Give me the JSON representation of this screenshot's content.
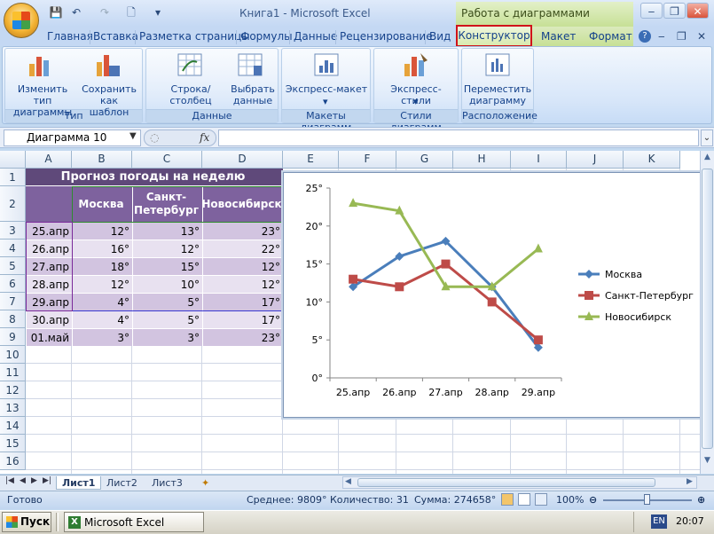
{
  "window": {
    "title": "Книга1 - Microsoft Excel",
    "context_title": "Работа с диаграммами"
  },
  "tabs": [
    "Главная",
    "Вставка",
    "Разметка страницы",
    "Формулы",
    "Данные",
    "Рецензирование",
    "Вид"
  ],
  "context_tabs": [
    "Конструктор",
    "Макет",
    "Формат"
  ],
  "ribbon": {
    "groups": [
      {
        "label": "Тип",
        "buttons": [
          "Изменить тип диаграммы",
          "Сохранить как шаблон"
        ]
      },
      {
        "label": "Данные",
        "buttons": [
          "Строка/столбец",
          "Выбрать данные"
        ]
      },
      {
        "label": "Макеты диаграмм",
        "buttons": [
          "Экспресс-макет"
        ]
      },
      {
        "label": "Стили диаграмм",
        "buttons": [
          "Экспресс-стили"
        ]
      },
      {
        "label": "Расположение",
        "buttons": [
          "Переместить диаграмму"
        ]
      }
    ]
  },
  "formula_bar": {
    "name_box": "Диаграмма 10",
    "fx": "fx",
    "value": ""
  },
  "columns": [
    "A",
    "B",
    "C",
    "D",
    "E",
    "F",
    "G",
    "H",
    "I",
    "J",
    "K"
  ],
  "rows": [
    "1",
    "2",
    "3",
    "4",
    "5",
    "6",
    "7",
    "8",
    "9",
    "10",
    "11",
    "12",
    "13",
    "14",
    "15",
    "16"
  ],
  "table": {
    "title": "Прогноз погоды на неделю",
    "headers": [
      "Москва",
      "Санкт-Петербург",
      "Новосибирск"
    ],
    "data": [
      [
        "25.апр",
        "12°",
        "13°",
        "23°"
      ],
      [
        "26.апр",
        "16°",
        "12°",
        "22°"
      ],
      [
        "27.апр",
        "18°",
        "15°",
        "12°"
      ],
      [
        "28.апр",
        "12°",
        "10°",
        "12°"
      ],
      [
        "29.апр",
        "4°",
        "5°",
        "17°"
      ],
      [
        "30.апр",
        "4°",
        "5°",
        "17°"
      ],
      [
        "01.май",
        "3°",
        "3°",
        "23°"
      ]
    ]
  },
  "chart_data": {
    "type": "line",
    "categories": [
      "25.апр",
      "26.апр",
      "27.апр",
      "28.апр",
      "29.апр"
    ],
    "series": [
      {
        "name": "Москва",
        "values": [
          12,
          16,
          18,
          12,
          4
        ],
        "color": "#4a7ebb",
        "marker": "diamond"
      },
      {
        "name": "Санкт-Петербург",
        "values": [
          13,
          12,
          15,
          10,
          5
        ],
        "color": "#be4b48",
        "marker": "square"
      },
      {
        "name": "Новосибирск",
        "values": [
          23,
          22,
          12,
          12,
          17
        ],
        "color": "#98b954",
        "marker": "triangle"
      }
    ],
    "yticks": [
      "0°",
      "5°",
      "10°",
      "15°",
      "20°",
      "25°"
    ],
    "ylim": [
      0,
      25
    ],
    "legend": "right",
    "grid": false
  },
  "sheets": [
    "Лист1",
    "Лист2",
    "Лист3"
  ],
  "active_sheet": "Лист1",
  "status": {
    "ready": "Готово",
    "average": "Среднее: 9809°",
    "count": "Количество: 31",
    "sum": "Сумма: 274658°",
    "zoom": "100%"
  },
  "taskbar": {
    "start": "Пуск",
    "task": "Microsoft Excel",
    "lang": "EN",
    "clock": "20:07"
  }
}
